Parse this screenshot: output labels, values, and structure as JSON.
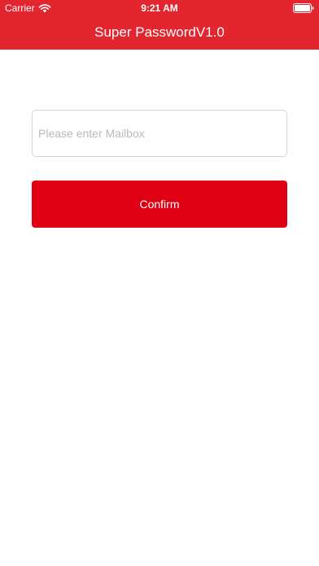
{
  "status_bar": {
    "carrier": "Carrier",
    "time": "9:21 AM",
    "wifi_icon": "wifi-icon",
    "battery_icon": "battery-full-icon"
  },
  "nav": {
    "title": "Super PasswordV1.0"
  },
  "form": {
    "email_placeholder": "Please enter Mailbox",
    "email_value": "",
    "confirm_label": "Confirm"
  },
  "colors": {
    "header_background": "#e3252f",
    "button_background": "#df0014",
    "text_on_accent": "#ffffff",
    "input_border": "#d4d4d4",
    "placeholder_text": "#b9b9b9"
  }
}
